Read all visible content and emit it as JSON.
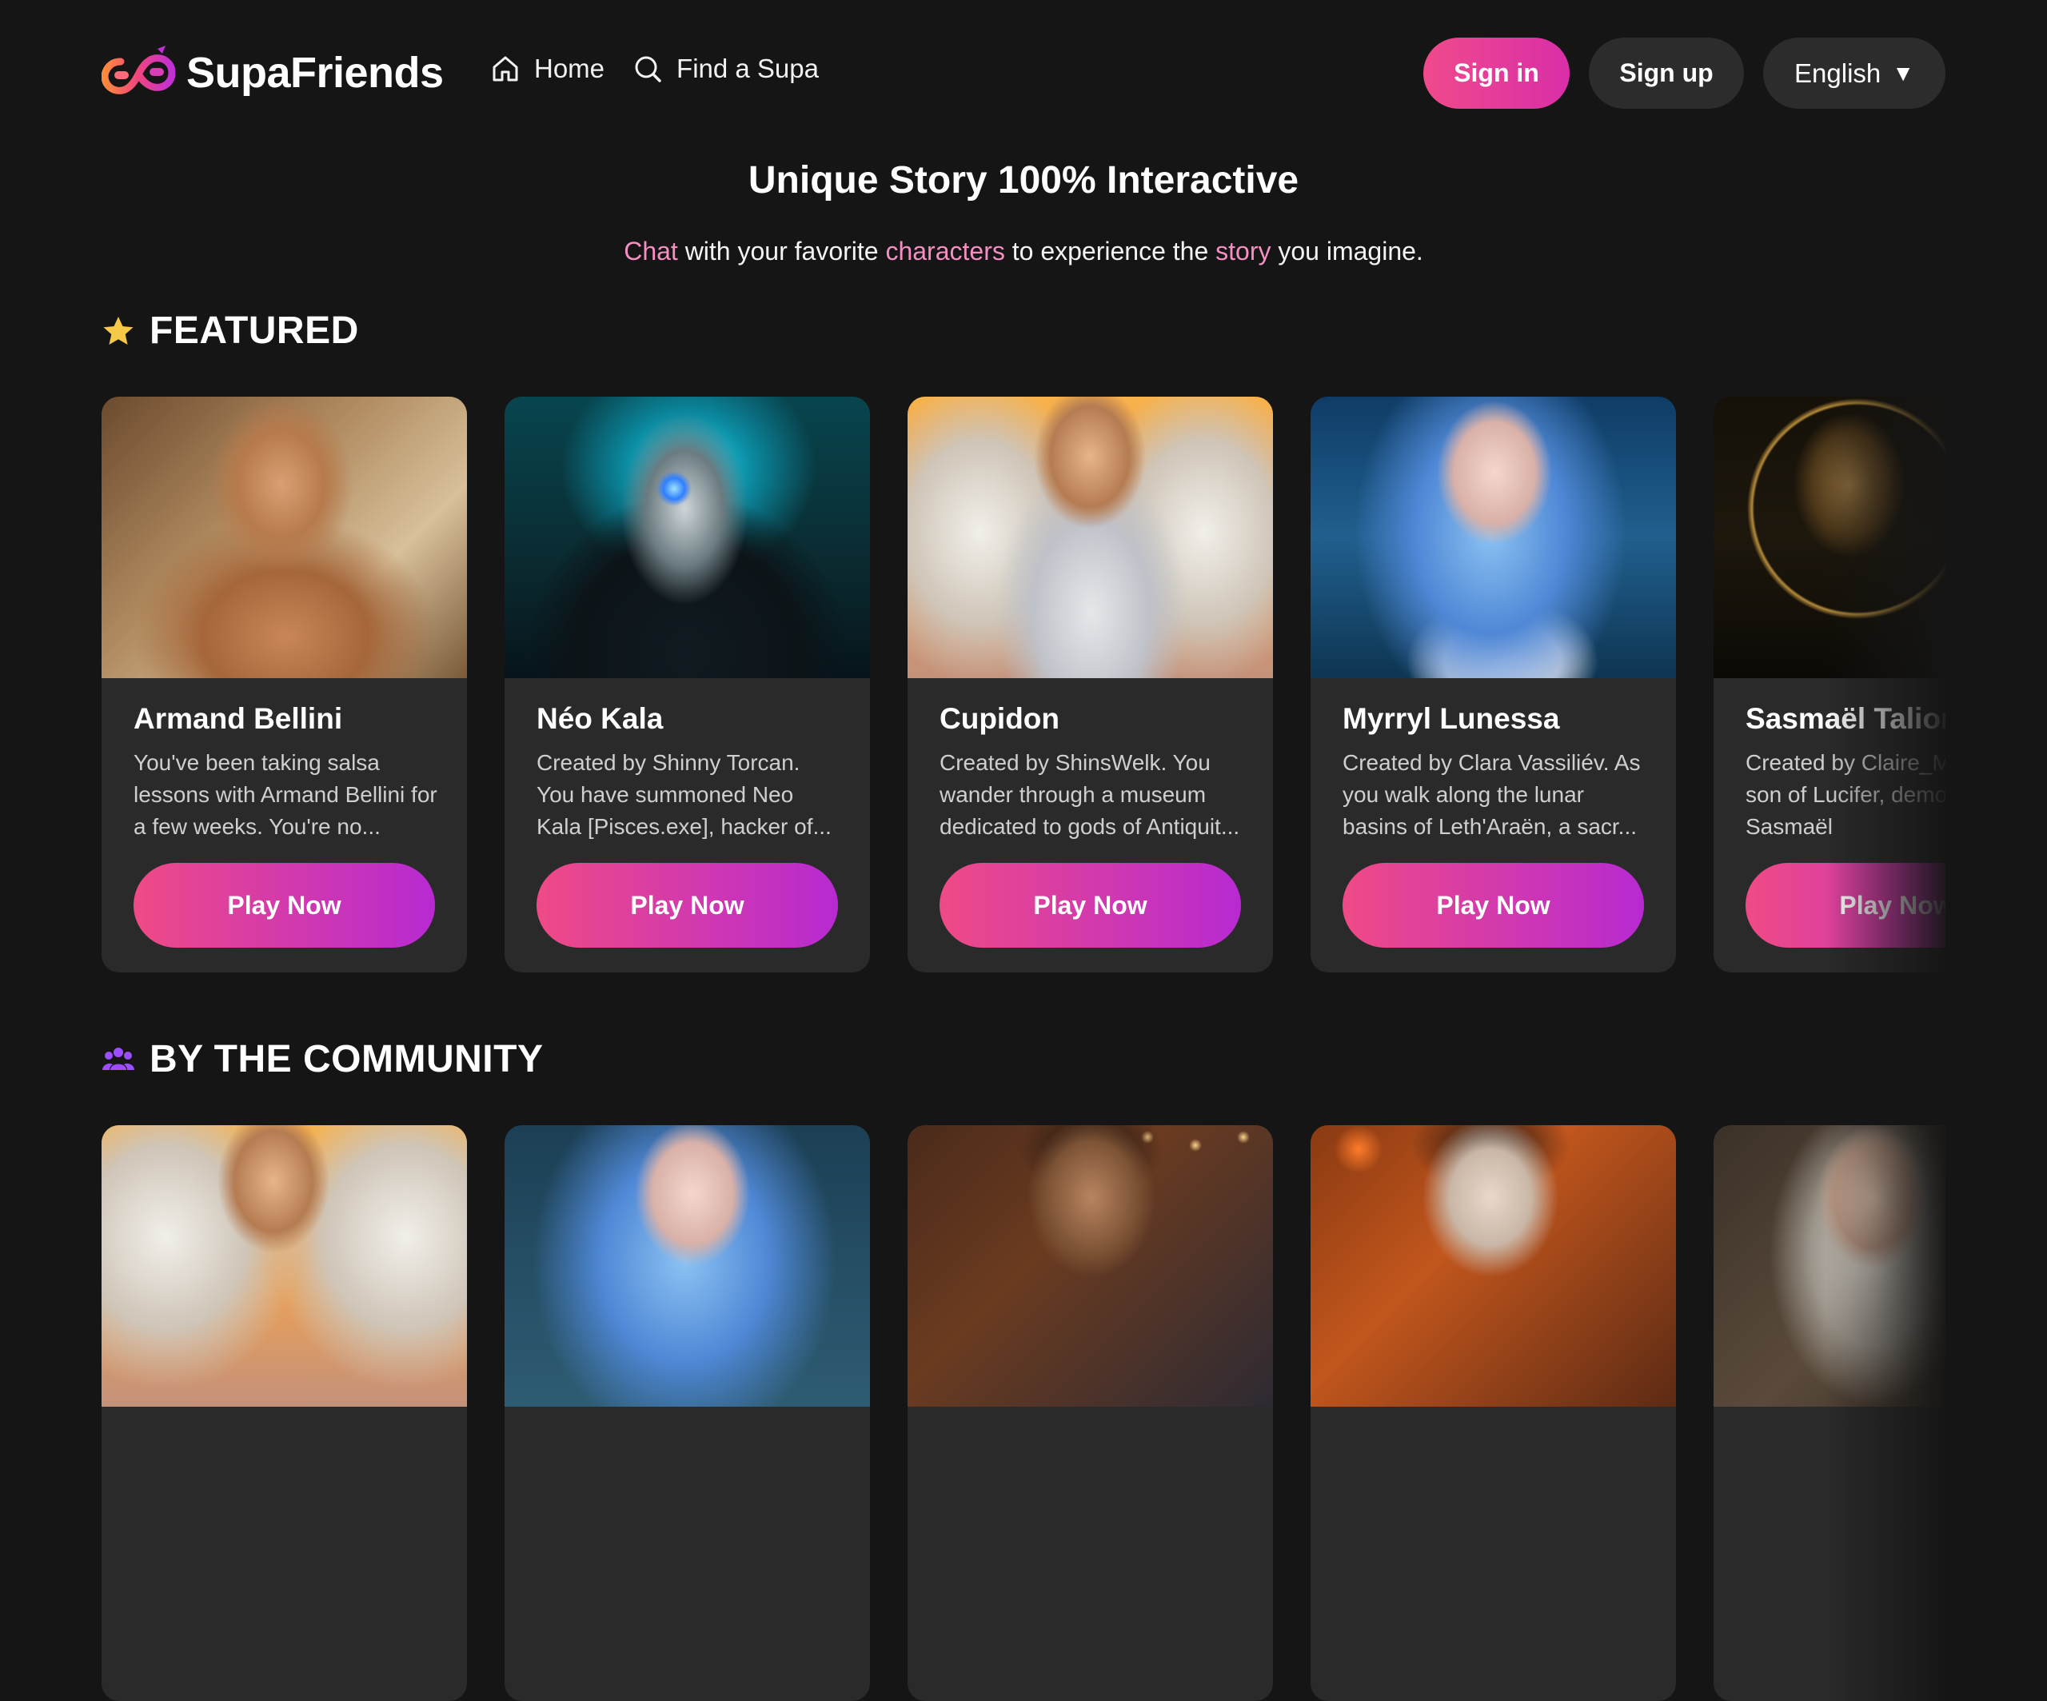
{
  "header": {
    "brand": "SupaFriends",
    "nav": [
      {
        "label": "Home",
        "icon": "home-icon"
      },
      {
        "label": "Find a Supa",
        "icon": "search-icon"
      }
    ],
    "signin_label": "Sign in",
    "signup_label": "Sign up",
    "language": "English",
    "language_caret": "▼"
  },
  "hero": {
    "title": "Unique Story 100% Interactive",
    "subtitle_parts": [
      "Chat",
      " with your favorite ",
      "characters",
      " to experience the ",
      "story",
      " you imagine."
    ]
  },
  "featured": {
    "title": "FEATURED",
    "icon": "star-icon",
    "cards": [
      {
        "name": "Armand Bellini",
        "desc": "You've been taking salsa lessons with Armand Bellini for a few weeks. You're no...",
        "cta": "Play Now"
      },
      {
        "name": "Néo Kala",
        "desc": "Created by Shinny Torcan. You have summoned Neo Kala [Pisces.exe], hacker of...",
        "cta": "Play Now"
      },
      {
        "name": "Cupidon",
        "desc": "Created by ShinsWelk. You wander through a museum dedicated to gods of Antiquit...",
        "cta": "Play Now"
      },
      {
        "name": "Myrryl Lunessa",
        "desc": "Created by Clara Vassiliév. As you walk along the lunar basins of Leth'Araën, a sacr...",
        "cta": "Play Now"
      },
      {
        "name": "Sasmaël Talion",
        "desc": "Created by Claire_M. The last son of Lucifer, demon prince. Sasmaël",
        "cta": "Play Now"
      }
    ]
  },
  "community": {
    "title": "BY THE COMMUNITY",
    "icon": "community-icon"
  },
  "colors": {
    "background": "#151515",
    "card": "#2a2a2a",
    "accent_pink": "#ef4a86",
    "accent_purple": "#b72ad1",
    "highlight_text": "#f48fc3",
    "star": "#f7c948",
    "community_icon": "#9b4dff"
  }
}
